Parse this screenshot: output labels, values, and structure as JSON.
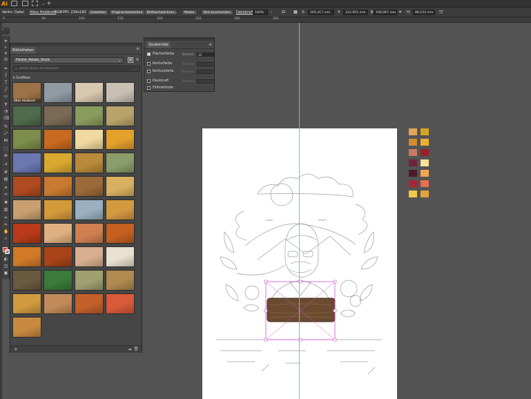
{
  "app": {
    "logo": "Ai"
  },
  "control_bar": {
    "object_type": "Verkn. Datei",
    "file_name": "Altes Holzbrett",
    "color_mode": "RGB",
    "ppi": "PPI: 239x182",
    "embed_label": "Einbetten",
    "edit_original_label": "Original bearbeiten",
    "image_trace_label": "Bildnachzeichner",
    "mask_label": "Maske",
    "crop_label": "Bild zuschneiden",
    "opacity_label": "Deckkraft:",
    "opacity_value": "100%",
    "x_label": "X:",
    "x_value": "205,417 mm",
    "y_label": "Y:",
    "y_value": "322,955 mm",
    "w_label": "B:",
    "w_value": "106,067 mm",
    "h_label": "H:",
    "h_value": "88,153 mm"
  },
  "ruler": {
    "ticks": [
      "0",
      "50",
      "100",
      "150",
      "200",
      "250",
      "300",
      "350"
    ]
  },
  "libraries": {
    "tab_label": "Bibliotheken",
    "library_name": "Herbst_Adobe_Stock",
    "search_placeholder": "Adobe Stock durchsuchen",
    "section_label": "Grafiken",
    "first_item_label": "Altes Holzbrett"
  },
  "magic_wand": {
    "tab_label": "Zauberstab",
    "rows": [
      {
        "label": "Flächenfarbe",
        "checked": true,
        "tolerance_label": "Toleranz:",
        "tolerance_value": "32"
      },
      {
        "label": "Konturfarbe",
        "checked": false,
        "tolerance_label": "Toleranz:",
        "tolerance_value": ""
      },
      {
        "label": "Konturstärke",
        "checked": false,
        "tolerance_label": "Toleranz:",
        "tolerance_value": ""
      },
      {
        "label": "Deckkraft",
        "checked": false,
        "tolerance_label": "Toleranz:",
        "tolerance_value": ""
      },
      {
        "label": "Füllmethode",
        "checked": false,
        "tolerance_label": "",
        "tolerance_value": ""
      }
    ]
  },
  "swatches": {
    "left": [
      "#e5a45a",
      "#d48a2d",
      "#c97b63",
      "#6e2340",
      "#4a1a2c",
      "#a8263a",
      "#f0c84a"
    ],
    "right": [
      "#d4a520",
      "#efb030",
      "#9a1f2a",
      "#fbe29a",
      "#f2a550",
      "#e86e4e",
      "#e3a33b"
    ]
  },
  "thumb_colors": [
    "#9c7249",
    "#8f9aa3",
    "#d8c8b0",
    "#c9c0b4",
    "#4f6b4c",
    "#7a6a55",
    "#8a9b5e",
    "#b9a36a",
    "#7d8d4a",
    "#c86a1f",
    "#f0d9a0",
    "#e3a02b",
    "#6b78b0",
    "#d9a830",
    "#b88a3a",
    "#8a9d6a",
    "#b04a20",
    "#c87a30",
    "#9a6a3a",
    "#d9b060",
    "#c8a070",
    "#d39a3a",
    "#9ab0c0",
    "#d49a40",
    "#b83a1a",
    "#e0b080",
    "#d08050",
    "#c46020",
    "#d07a28",
    "#a84418",
    "#d8b090",
    "#e8e0d0",
    "#6a5a40",
    "#3a7a3a",
    "#a0a070",
    "#b08a50",
    "#d09a40",
    "#c28a5a",
    "#c4602a",
    "#d85a3a",
    "#c88a40"
  ]
}
